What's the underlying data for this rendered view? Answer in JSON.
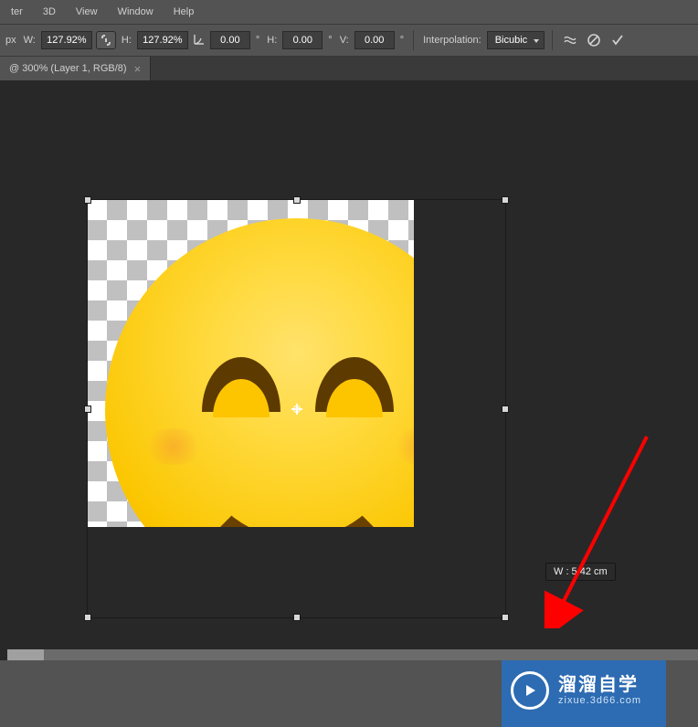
{
  "menu": {
    "items": [
      "ter",
      "3D",
      "View",
      "Window",
      "Help"
    ]
  },
  "options": {
    "unit_label": "px",
    "w_label": "W:",
    "w_value": "127.92%",
    "h_label": "H:",
    "h_value": "127.92%",
    "angle_value": "0.00",
    "skew_h_label": "H:",
    "skew_h_value": "0.00",
    "skew_v_label": "V:",
    "skew_v_value": "0.00",
    "interpolation_label": "Interpolation:",
    "interpolation_value": "Bicubic"
  },
  "tab": {
    "title": "@ 300% (Layer 1, RGB/8)",
    "close": "×"
  },
  "tooltip": {
    "text": "W : 5.42 cm"
  },
  "watermark": {
    "cn": "溜溜自学",
    "url": "zixue.3d66.com"
  }
}
